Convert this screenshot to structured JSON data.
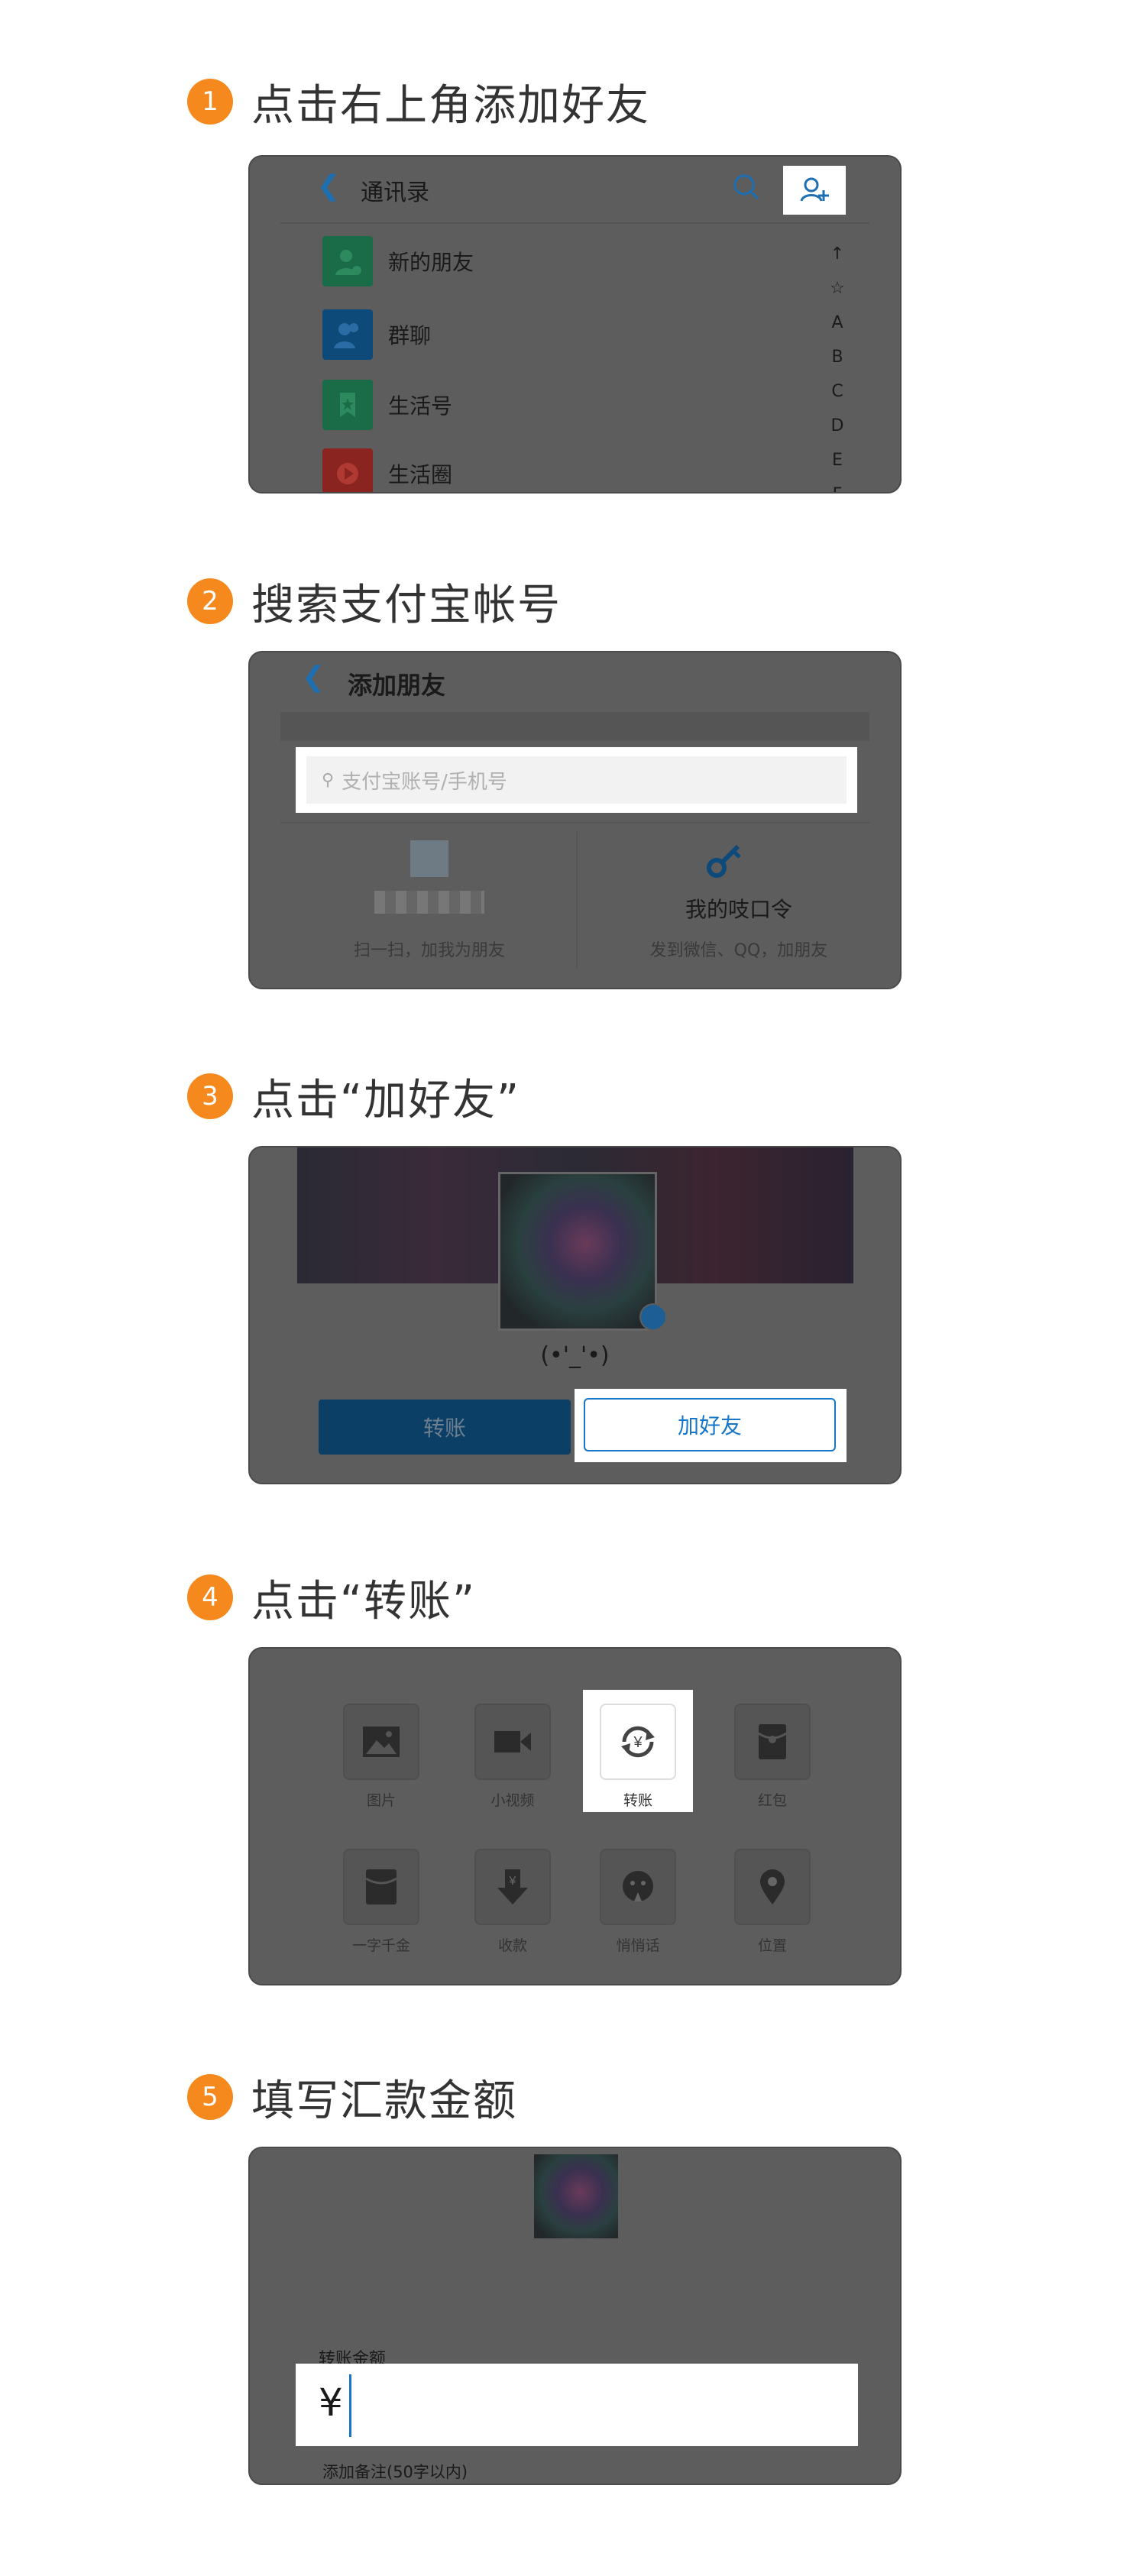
{
  "steps": [
    {
      "num": "1",
      "title": "点击右上角添加好友"
    },
    {
      "num": "2",
      "title": "搜索支付宝帐号"
    },
    {
      "num": "3",
      "title": "点击“加好友”"
    },
    {
      "num": "4",
      "title": "点击“转账”"
    },
    {
      "num": "5",
      "title": "填写汇款金额"
    }
  ],
  "contacts": {
    "title": "通讯录",
    "items": [
      {
        "label": "新的朋友",
        "color": "#1a6b47"
      },
      {
        "label": "群聊",
        "color": "#0d4a7a"
      },
      {
        "label": "生活号",
        "color": "#1a6b47"
      },
      {
        "label": "生活圈",
        "color": "#8a2420"
      }
    ],
    "index": [
      "↑",
      "☆",
      "A",
      "B",
      "C",
      "D",
      "E",
      "F"
    ]
  },
  "add_friend": {
    "title": "添加朋友",
    "search_placeholder": "支付宝账号/手机号",
    "scan_caption": "扫一扫，加我为朋友",
    "code_title": "我的吱口令",
    "code_caption": "发到微信、QQ，加朋友"
  },
  "profile": {
    "nickname": "(•'_'•)",
    "transfer_label": "转账",
    "add_friend_label": "加好友"
  },
  "chat_tools": [
    {
      "label": "图片",
      "icon": "image-icon"
    },
    {
      "label": "小视频",
      "icon": "video-icon"
    },
    {
      "label": "转账",
      "icon": "transfer-icon"
    },
    {
      "label": "红包",
      "icon": "red-packet-icon"
    },
    {
      "label": "一字千金",
      "icon": "word-gold-icon"
    },
    {
      "label": "收款",
      "icon": "receive-icon"
    },
    {
      "label": "悄悄话",
      "icon": "whisper-icon"
    },
    {
      "label": "位置",
      "icon": "location-icon"
    }
  ],
  "transfer": {
    "amount_label": "转账金额",
    "currency": "¥",
    "note_label": "添加备注(50字以内)"
  },
  "colors": {
    "accent": "#f5891e",
    "link_blue": "#1677c9",
    "overlay": "#5d5d5d"
  }
}
